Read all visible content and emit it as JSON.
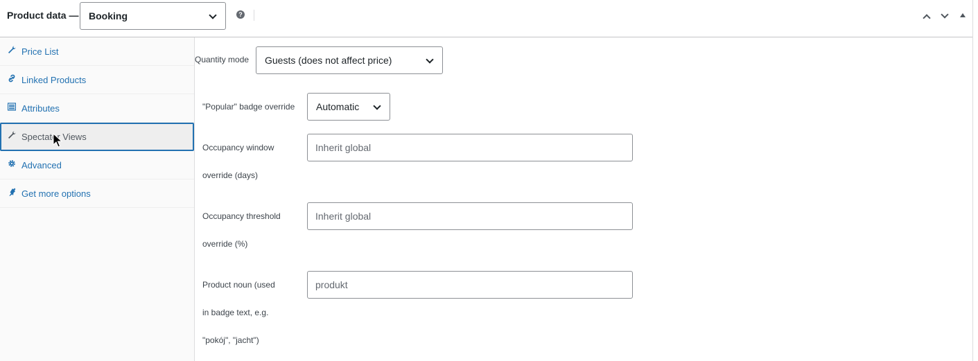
{
  "header": {
    "title": "Product data —",
    "product_type": "Booking",
    "help": "?"
  },
  "sidebar": {
    "items": [
      {
        "label": "Price List",
        "icon": "wrench-icon",
        "glyph": "🔧"
      },
      {
        "label": "Linked Products",
        "icon": "link-icon",
        "glyph": "🔗"
      },
      {
        "label": "Attributes",
        "icon": "list-icon",
        "glyph": "▤"
      },
      {
        "label": "Spectator Views",
        "icon": "wrench-icon",
        "glyph": "🔧",
        "active": true
      },
      {
        "label": "Advanced",
        "icon": "gear-icon",
        "glyph": "⚙"
      },
      {
        "label": "Get more options",
        "icon": "plugin-icon",
        "glyph": "🔌"
      }
    ]
  },
  "fields": {
    "quantity_mode": {
      "label": "Quantity mode",
      "value": "Guests (does not affect price)"
    },
    "popular_badge": {
      "label": "\"Popular\" badge override",
      "value": "Automatic"
    },
    "occupancy_window": {
      "label_line1": "Occupancy window",
      "label_line2": "override (days)",
      "placeholder": "Inherit global"
    },
    "occupancy_threshold": {
      "label_line1": "Occupancy threshold",
      "label_line2": "override (%)",
      "placeholder": "Inherit global"
    },
    "product_noun": {
      "label_line1": "Product noun (used",
      "label_line2": "in badge text, e.g.",
      "label_line3": "\"pokój\", \"jacht\")",
      "placeholder": "produkt"
    }
  }
}
